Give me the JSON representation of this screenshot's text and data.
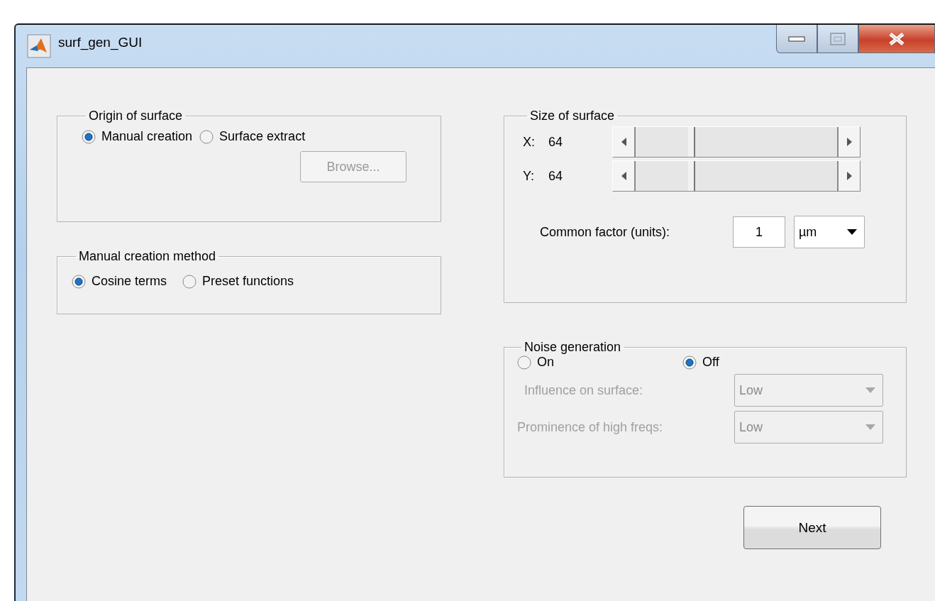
{
  "window": {
    "title": "surf_gen_GUI"
  },
  "origin": {
    "title": "Origin of surface",
    "options": [
      {
        "label": "Manual creation",
        "selected": true
      },
      {
        "label": "Surface extract",
        "selected": false
      }
    ],
    "browse": {
      "label": "Browse...",
      "disabled": true
    }
  },
  "method": {
    "title": "Manual creation method",
    "options": [
      {
        "label": "Cosine terms",
        "selected": true
      },
      {
        "label": "Preset functions",
        "selected": false
      }
    ]
  },
  "size": {
    "title": "Size of surface",
    "sliders": [
      {
        "axis": "X:",
        "value": "64",
        "level": 0.27
      },
      {
        "axis": "Y:",
        "value": "64",
        "level": 0.27
      }
    ],
    "factor": {
      "label": "Common factor (units):",
      "value": "1",
      "unit": "µm"
    }
  },
  "noise": {
    "title": "Noise generation",
    "options": [
      {
        "label": "On",
        "selected": false
      },
      {
        "label": "Off",
        "selected": true
      }
    ],
    "settings": [
      {
        "label": "Influence on surface:",
        "value": "Low",
        "disabled": true
      },
      {
        "label": "Prominence of high freqs:",
        "value": "Low",
        "disabled": true
      }
    ]
  },
  "next_button": "Next"
}
